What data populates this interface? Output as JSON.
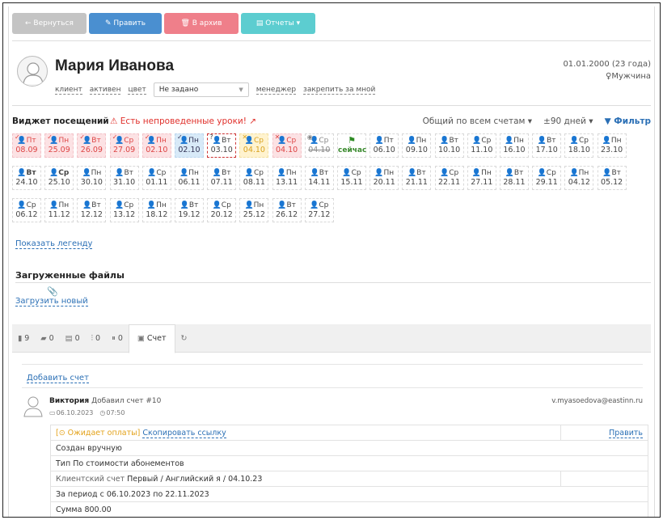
{
  "toolbar": {
    "back": "← Вернуться",
    "edit": "✎ Править",
    "archive": "🗑 В архив",
    "reports": "▤ Отчеты ▾"
  },
  "profile": {
    "name": "Мария Иванова",
    "status_client": "клиент",
    "status_active": "активен",
    "color_label": "цвет",
    "select_value": "Не задано",
    "manager_label": "менеджер",
    "assign_label": "закрепить за мной",
    "birthdate": "01.01.2000 (23 года)",
    "gender": "♀Мужчина"
  },
  "widget": {
    "title": "Виджет посещений",
    "alert": "⚠ Есть непроведенные уроки! ↗",
    "scope": "Общий по всем счетам ▾",
    "period": "±90 дней ▾",
    "filter": "▼ Фильтр",
    "legend_link": "Показать легенду",
    "rows": [
      [
        {
          "d1": "👤Пт",
          "d2": "08.09",
          "s": "red",
          "m": "✓"
        },
        {
          "d1": "👤Пн",
          "d2": "25.09",
          "s": "red",
          "m": "✓"
        },
        {
          "d1": "👤Вт",
          "d2": "26.09",
          "s": "red",
          "m": "✓"
        },
        {
          "d1": "👤Ср",
          "d2": "27.09",
          "s": "red",
          "m": "✓"
        },
        {
          "d1": "👤Пн",
          "d2": "02.10",
          "s": "red",
          "m": "✓"
        },
        {
          "d1": "👤Пн",
          "d2": "02.10",
          "s": "blue",
          "m": "✓"
        },
        {
          "d1": "👤Вт",
          "d2": "03.10",
          "s": "now",
          "m": "?"
        },
        {
          "d1": "👤Ср",
          "d2": "04.10",
          "s": "yellow",
          "m": "✕"
        },
        {
          "d1": "👤Ср",
          "d2": "04.10",
          "s": "red",
          "m": "✕"
        },
        {
          "d1": "👤Ср",
          "d2": "04.10",
          "s": "gray",
          "m": "◉"
        },
        {
          "d1": "⚑",
          "d2": "сейчас",
          "s": "flag",
          "m": ""
        },
        {
          "d1": "👤Пт",
          "d2": "06.10",
          "s": "norm",
          "m": ""
        },
        {
          "d1": "👤Пн",
          "d2": "09.10",
          "s": "norm",
          "m": ""
        },
        {
          "d1": "👤Вт",
          "d2": "10.10",
          "s": "norm",
          "m": ""
        },
        {
          "d1": "👤Ср",
          "d2": "11.10",
          "s": "norm",
          "m": ""
        },
        {
          "d1": "👤Пн",
          "d2": "16.10",
          "s": "norm",
          "m": ""
        },
        {
          "d1": "👤Вт",
          "d2": "17.10",
          "s": "norm",
          "m": ""
        },
        {
          "d1": "👤Ср",
          "d2": "18.10",
          "s": "norm",
          "m": ""
        },
        {
          "d1": "👤Пн",
          "d2": "23.10",
          "s": "norm",
          "m": ""
        }
      ],
      [
        {
          "d1": "👤Вт",
          "d2": "24.10",
          "s": "bold",
          "m": ""
        },
        {
          "d1": "👤Ср",
          "d2": "25.10",
          "s": "bold",
          "m": ""
        },
        {
          "d1": "👤Пн",
          "d2": "30.10",
          "s": "norm",
          "m": ""
        },
        {
          "d1": "👤Вт",
          "d2": "31.10",
          "s": "norm",
          "m": ""
        },
        {
          "d1": "👤Ср",
          "d2": "01.11",
          "s": "norm",
          "m": ""
        },
        {
          "d1": "👤Пн",
          "d2": "06.11",
          "s": "norm",
          "m": ""
        },
        {
          "d1": "👤Вт",
          "d2": "07.11",
          "s": "norm",
          "m": ""
        },
        {
          "d1": "👤Ср",
          "d2": "08.11",
          "s": "norm",
          "m": ""
        },
        {
          "d1": "👤Пн",
          "d2": "13.11",
          "s": "norm",
          "m": ""
        },
        {
          "d1": "👤Вт",
          "d2": "14.11",
          "s": "norm",
          "m": ""
        },
        {
          "d1": "👤Ср",
          "d2": "15.11",
          "s": "norm",
          "m": ""
        },
        {
          "d1": "👤Пн",
          "d2": "20.11",
          "s": "norm",
          "m": ""
        },
        {
          "d1": "👤Вт",
          "d2": "21.11",
          "s": "norm",
          "m": ""
        },
        {
          "d1": "👤Ср",
          "d2": "22.11",
          "s": "norm",
          "m": ""
        },
        {
          "d1": "👤Пн",
          "d2": "27.11",
          "s": "norm",
          "m": ""
        },
        {
          "d1": "👤Вт",
          "d2": "28.11",
          "s": "norm",
          "m": ""
        },
        {
          "d1": "👤Ср",
          "d2": "29.11",
          "s": "norm",
          "m": ""
        },
        {
          "d1": "👤Пн",
          "d2": "04.12",
          "s": "norm",
          "m": ""
        },
        {
          "d1": "👤Вт",
          "d2": "05.12",
          "s": "norm",
          "m": ""
        }
      ],
      [
        {
          "d1": "👤Ср",
          "d2": "06.12",
          "s": "norm",
          "m": ""
        },
        {
          "d1": "👤Пн",
          "d2": "11.12",
          "s": "norm",
          "m": ""
        },
        {
          "d1": "👤Вт",
          "d2": "12.12",
          "s": "norm",
          "m": ""
        },
        {
          "d1": "👤Ср",
          "d2": "13.12",
          "s": "norm",
          "m": ""
        },
        {
          "d1": "👤Пн",
          "d2": "18.12",
          "s": "norm",
          "m": ""
        },
        {
          "d1": "👤Вт",
          "d2": "19.12",
          "s": "norm",
          "m": ""
        },
        {
          "d1": "👤Ср",
          "d2": "20.12",
          "s": "norm",
          "m": ""
        },
        {
          "d1": "👤Пн",
          "d2": "25.12",
          "s": "norm",
          "m": ""
        },
        {
          "d1": "👤Вт",
          "d2": "26.12",
          "s": "norm",
          "m": ""
        },
        {
          "d1": "👤Ср",
          "d2": "27.12",
          "s": "norm",
          "m": ""
        }
      ]
    ]
  },
  "files": {
    "title": "Загруженные файлы",
    "upload": "Загрузить новый"
  },
  "tabs": [
    {
      "icon": "▮",
      "label": "9"
    },
    {
      "icon": "▰",
      "label": "0"
    },
    {
      "icon": "▤",
      "label": "0"
    },
    {
      "icon": "⫶",
      "label": "0"
    },
    {
      "icon": "⏸",
      "label": "0"
    },
    {
      "icon": "▣",
      "label": "Счет"
    },
    {
      "icon": "↻",
      "label": ""
    }
  ],
  "account": {
    "add_link": "Добавить счет",
    "author": "Виктория",
    "action": "Добавил счет #10",
    "date": "06.10.2023",
    "time": "07:50",
    "email": "v.myasoedova@eastinn.ru",
    "status": "[⊙ Ожидает оплаты]",
    "copy_link": "Скопировать ссылку",
    "edit_link": "Править",
    "created": "Создан вручную",
    "type_label": "Тип",
    "type_value": "По стоимости абонементов",
    "client_label": "Клиентский счет",
    "client_value": "Первый / Английский я / 04.10.23",
    "period": "За период с 06.10.2023 по 22.11.2023",
    "sum_label": "Сумма",
    "sum_value": "800.00"
  }
}
